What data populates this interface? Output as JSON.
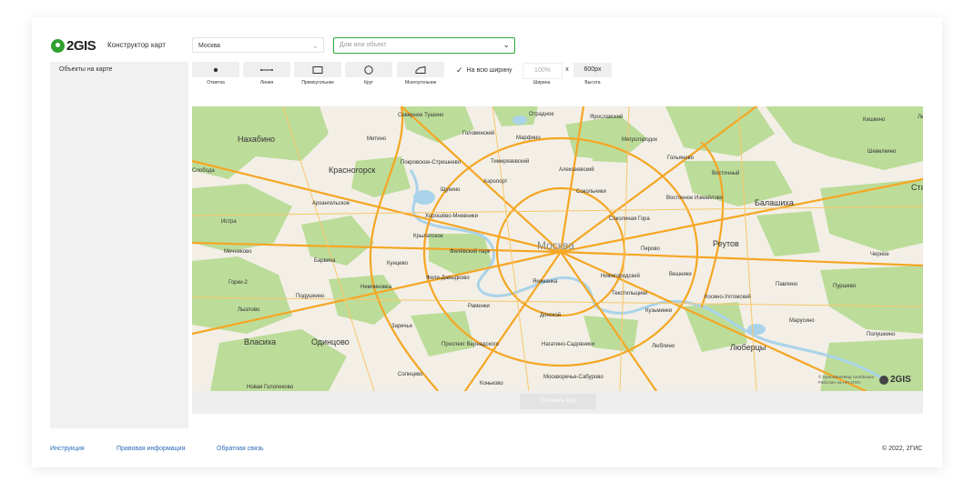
{
  "header": {
    "logo_text": "2GIS",
    "subtitle": "Конструктор карт",
    "city_select": "Москва",
    "search_placeholder": "Дом или объект"
  },
  "sidebar": {
    "title": "Объекты на карте"
  },
  "tools": [
    {
      "label": "Отметка",
      "icon": "point-icon"
    },
    {
      "label": "Линия",
      "icon": "line-icon"
    },
    {
      "label": "Прямоугольник",
      "icon": "rectangle-icon"
    },
    {
      "label": "Круг",
      "icon": "circle-icon"
    },
    {
      "label": "Многоугольник",
      "icon": "polygon-icon"
    }
  ],
  "size": {
    "full_width_label": "На всю ширину",
    "full_width_checked": true,
    "width_value": "100%",
    "separator": "x",
    "height_value": "600px",
    "width_label": "Ширина",
    "height_label": "Высота"
  },
  "map": {
    "city": "Москва",
    "labels": {
      "severnoe_tushino": "Северное Тушино",
      "otradnoe": "Отрадное",
      "yaroslavsky": "Ярославский",
      "kishkino": "Кишкино",
      "nakhabino": "Нахабино",
      "mitino": "Митино",
      "golovinsky": "Головинский",
      "marfino": "Марфино",
      "metrogorodok": "Метрогородок",
      "sheveleno": "Шевелкино",
      "sloboda": "Слобода",
      "krasnogorsk": "Красногорск",
      "pokrovskoe": "Покровское-Стрешнево",
      "timiryazevsky": "Тимирязевский",
      "alekseevsky": "Алексеевский",
      "golyanovo": "Гольяново",
      "vostochny": "Восточный",
      "aeroport": "Аэропорт",
      "sokolniki": "Сокольники",
      "arkhangelskoe": "Архангельское",
      "shchukino": "Щукино",
      "vostochnoe_izmaylovo": "Восточное Измайлово",
      "balashikha": "Балашиха",
      "istra": "Истра",
      "khoroshevo": "Хорошёво-Мневники",
      "sokolinaya_gora": "Соколиная Гора",
      "krylatskoe": "Крылатское",
      "filevsky_park": "Филёвский парк",
      "perovo": "Перово",
      "reutov": "Реутов",
      "mechnikovo": "Мечниково",
      "barvikha": "Барвиха",
      "kuntsevo": "Кунцево",
      "fili": "Фили-Давыдково",
      "yakimanka": "Якиманка",
      "nizhegorodsky": "Нижегородский",
      "veshnyaki": "Вешняки",
      "gorki2": "Горки-2",
      "nemchinovka": "Немчиновка",
      "tekstilshchiki": "Текстильщики",
      "kosino": "Косино-Ухтомский",
      "pavlino": "Павлино",
      "purshevo": "Пуршево",
      "podushkino": "Подушкино",
      "ramenki": "Раменки",
      "donskoy": "Донской",
      "kuzminki": "Кузьминки",
      "marusino": "Марусино",
      "lyzlovo": "Лызлово",
      "zarechye": "Заречье",
      "vlasikha": "Власиха",
      "odintsovo": "Одинцово",
      "prospekt_vernadskogo": "Проспект Вернадского",
      "nagatino": "Нагатино-Садовники",
      "lyublino": "Люблино",
      "lyubertsy": "Люберцы",
      "polushkino": "Полушкино",
      "solntsevo": "Солнцево",
      "moskvorechye": "Москворечье-Сабурово",
      "konkovo": "Коньково",
      "bolshaya_goloshchapovo": "Новая Голопеково",
      "cherepovo": "Черное",
      "sta": "Ста",
      "lyu": "Лю"
    },
    "attribution_line1": "© OpenStreetMap contributors",
    "attribution_line2": "Работает на API 2ГИС",
    "logo_text": "2GIS",
    "colors": {
      "park": "#bcdc9a",
      "water": "#a9d3ea",
      "road": "#f5a623",
      "land": "#f3efe6"
    }
  },
  "action": {
    "get_code_label": "Получить код"
  },
  "footer": {
    "links": [
      "Инструкция",
      "Правовая информация",
      "Обратная связь"
    ],
    "copyright": "© 2022, 2ГИС"
  }
}
